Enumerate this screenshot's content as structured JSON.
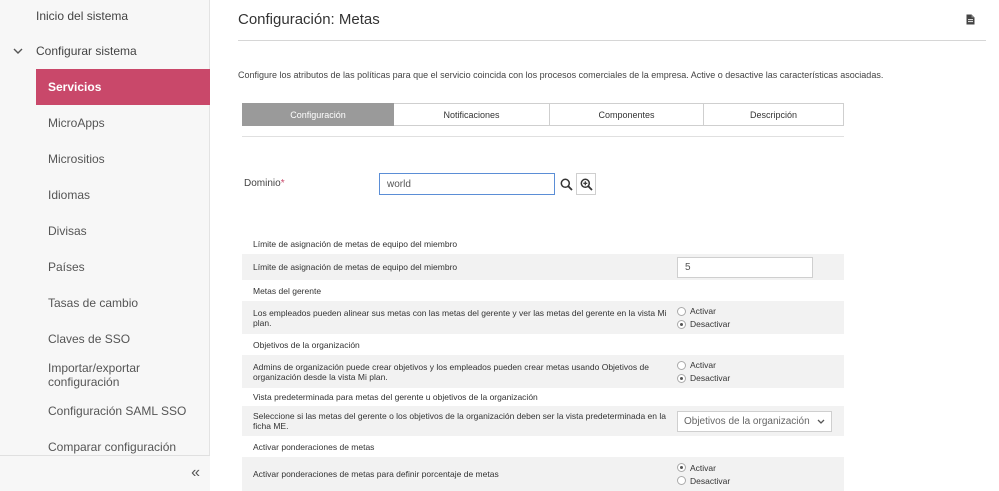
{
  "sidebar": {
    "top_item": "Inicio del sistema",
    "parent": "Configurar sistema",
    "items": [
      {
        "label": "Servicios",
        "active": true
      },
      {
        "label": "MicroApps"
      },
      {
        "label": "Micrositios"
      },
      {
        "label": "Idiomas"
      },
      {
        "label": "Divisas"
      },
      {
        "label": "Países"
      },
      {
        "label": "Tasas de cambio"
      },
      {
        "label": "Claves de SSO"
      },
      {
        "label": "Importar/exportar configuración"
      },
      {
        "label": "Configuración SAML SSO"
      },
      {
        "label": "Comparar configuración"
      }
    ],
    "collapse_glyph": "«"
  },
  "main": {
    "title": "Configuración: Metas",
    "intro": "Configure los atributos de las políticas para que el servicio coincida con los procesos comerciales de la empresa. Active o desactive las características asociadas.",
    "tabs": [
      {
        "label": "Configuración",
        "active": true
      },
      {
        "label": "Notificaciones"
      },
      {
        "label": "Componentes"
      },
      {
        "label": "Descripción"
      }
    ],
    "domain": {
      "label": "Dominio",
      "required_mark": "*",
      "value": "world"
    },
    "sections": [
      {
        "heading": "Límite de asignación de metas de equipo del miembro",
        "row_text": "Límite de asignación de metas de equipo del miembro",
        "control": "input",
        "value": "5"
      },
      {
        "heading": "Metas del gerente",
        "row_text": "Los empleados pueden alinear sus metas con las metas del gerente y ver las metas del gerente en la vista Mi plan.",
        "control": "radio",
        "options": [
          "Activar",
          "Desactivar"
        ],
        "selected": "Desactivar"
      },
      {
        "heading": "Objetivos de la organización",
        "row_text": "Admins de organización puede crear objetivos y los empleados pueden crear metas usando Objetivos de organización desde la vista Mi plan.",
        "control": "radio",
        "options": [
          "Activar",
          "Desactivar"
        ],
        "selected": "Desactivar"
      },
      {
        "heading": "Vista predeterminada para metas del gerente u objetivos de la organización",
        "row_text": "Seleccione si las metas del gerente o los objetivos de la organización deben ser la vista predeterminada en la ficha ME.",
        "control": "select",
        "value": "Objetivos de la organización"
      },
      {
        "heading": "Activar ponderaciones de metas",
        "row_text": "Activar ponderaciones de metas para definir porcentaje de metas",
        "control": "radio",
        "options": [
          "Activar",
          "Desactivar"
        ],
        "selected": "Activar"
      }
    ]
  },
  "colors": {
    "accent": "#c9486a",
    "tab_active": "#9a9a9a",
    "input_focus": "#5b8ed6"
  }
}
